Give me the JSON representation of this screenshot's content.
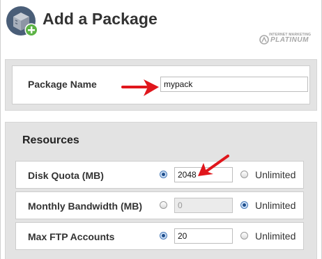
{
  "header": {
    "title": "Add a Package",
    "watermark_top": "INTERNET MARKETING",
    "watermark_main": "PLATINUM"
  },
  "package": {
    "label": "Package Name",
    "value": "mypack"
  },
  "resources": {
    "heading": "Resources",
    "rows": [
      {
        "label": "Disk Quota (MB)",
        "value": "2048",
        "value_selected": true,
        "unlimited_label": "Unlimited",
        "unlimited_selected": false,
        "disabled": false
      },
      {
        "label": "Monthly Bandwidth (MB)",
        "value": "0",
        "value_selected": false,
        "unlimited_label": "Unlimited",
        "unlimited_selected": true,
        "disabled": true
      },
      {
        "label": "Max FTP Accounts",
        "value": "20",
        "value_selected": true,
        "unlimited_label": "Unlimited",
        "unlimited_selected": false,
        "disabled": false
      }
    ]
  },
  "colors": {
    "arrow": "#e0161c",
    "radio_selected": "#1e4e8c",
    "panel_bg": "#e3e3e3"
  }
}
